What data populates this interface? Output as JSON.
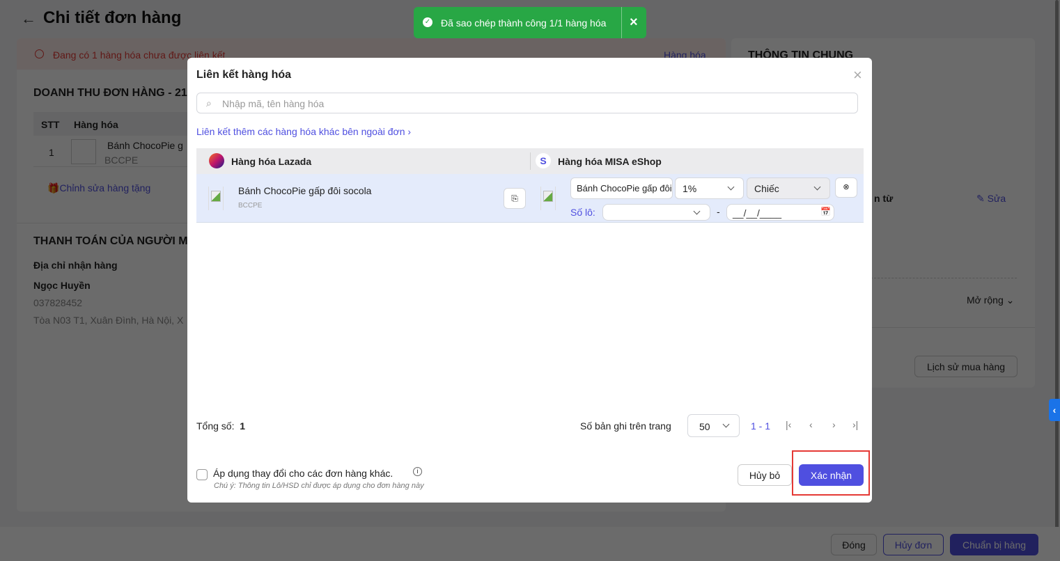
{
  "page": {
    "title": "Chi tiết đơn hàng",
    "alert": "Đang có 1 hàng hóa chưa được liên kết",
    "alert_link": "Hàng hóa",
    "revenue_title": "DOANH THU ĐƠN HÀNG  - 21",
    "table_headers": [
      "STT",
      "Hàng hóa"
    ],
    "row": {
      "stt": "1",
      "name": "Bánh ChocoPie g",
      "code": "BCCPE"
    },
    "gift_link": "Chỉnh sửa hàng tặng",
    "payment_title": "THANH TOÁN CỦA NGƯỜI M",
    "address_label": "Địa chỉ nhận hàng",
    "customer_name": "Ngọc Huyền",
    "phone": "037828452",
    "address": "Tòa N03 T1, Xuân Đình, Hà Nội, X",
    "general_title": "THÔNG TIN CHUNG",
    "partial_label": "n từ",
    "edit_link": "Sửa",
    "expand": "Mở rộng",
    "history_button": "Lịch sử mua hàng",
    "footer": {
      "close": "Đóng",
      "cancel_order": "Hủy đơn",
      "prepare": "Chuẩn bị hàng"
    }
  },
  "toast": {
    "message": "Đã sao chép thành công 1/1 hàng hóa",
    "close": "×"
  },
  "modal": {
    "title": "Liên kết hàng hóa",
    "search_placeholder": "Nhập mã, tên hàng hóa",
    "link_more": "Liên kết thêm các hàng hóa khác bên ngoài đơn",
    "col_lazada": "Hàng hóa Lazada",
    "col_eshop": "Hàng hóa MISA eShop",
    "item": {
      "name": "Bánh ChocoPie gấp đôi socola",
      "code": "BCCPE",
      "eshop_name": "Bánh ChocoPie gấp đôi socola",
      "percent": "1%",
      "unit": "Chiếc",
      "lot_label": "Số lô:",
      "lot_value": "",
      "date_placeholder": "__/__/____"
    },
    "total_label": "Tổng số:",
    "total": "1",
    "per_page_label": "Số bản ghi trên trang",
    "per_page": "50",
    "range": "1 - 1",
    "apply_label": "Áp dụng thay đổi cho các đơn hàng khác.",
    "note": "Chú ý: Thông tin Lô/HSD chỉ được áp dụng cho đơn hàng này",
    "cancel": "Hủy bỏ",
    "confirm": "Xác nhận"
  },
  "colors": {
    "primary": "#4f4fe0",
    "toast": "#28a745",
    "highlight": "#e53935"
  }
}
